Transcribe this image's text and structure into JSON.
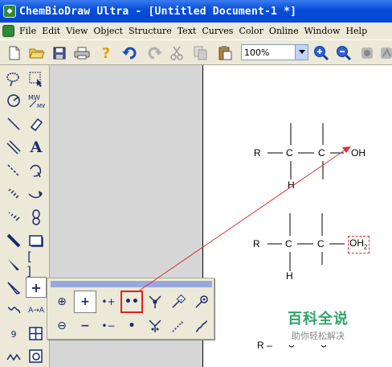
{
  "window": {
    "title": "ChemBioDraw Ultra - [Untitled Document-1 *]",
    "app_icon": "chembiodraw-app-icon"
  },
  "menu": {
    "items": [
      "File",
      "Edit",
      "View",
      "Object",
      "Structure",
      "Text",
      "Curves",
      "Color",
      "Online",
      "Window",
      "Help"
    ]
  },
  "toolbar": {
    "zoom_value": "100%",
    "buttons": [
      "new-doc-icon",
      "open-folder-icon",
      "save-icon",
      "print-icon",
      "help-icon",
      "undo-icon",
      "redo-icon",
      "cut-icon",
      "copy-icon",
      "paste-icon",
      "zoom-in-icon",
      "zoom-out-icon"
    ]
  },
  "palette": {
    "text_tool_label": "A",
    "bracket_label": "[ ]",
    "charge_tool_label": "+",
    "arrow_text_label": "A→A",
    "number_label": "9"
  },
  "flyout": {
    "row1": [
      "⊕",
      "+",
      "•+",
      "••"
    ],
    "row2": [
      "⊖",
      "−",
      "•−",
      "•"
    ]
  },
  "document": {
    "struct1": {
      "r_label": "R",
      "c1": "C",
      "c2": "C",
      "h_label": "H",
      "oh_label": "OH"
    },
    "struct2": {
      "r_label": "R",
      "c1": "C",
      "c2": "C",
      "h_label": "H",
      "oh2_label": "OH",
      "oh2_sub": "2"
    },
    "struct3": {
      "r_label": "R –"
    }
  },
  "watermark": {
    "main": "百科全说",
    "sub": "助你轻松解决"
  },
  "colors": {
    "titlebar": "#0a4fd8",
    "chrome": "#ece9d8",
    "highlight_red": "#e02020",
    "arrow_red": "#e03030",
    "watermark_green": "#30a46a"
  }
}
